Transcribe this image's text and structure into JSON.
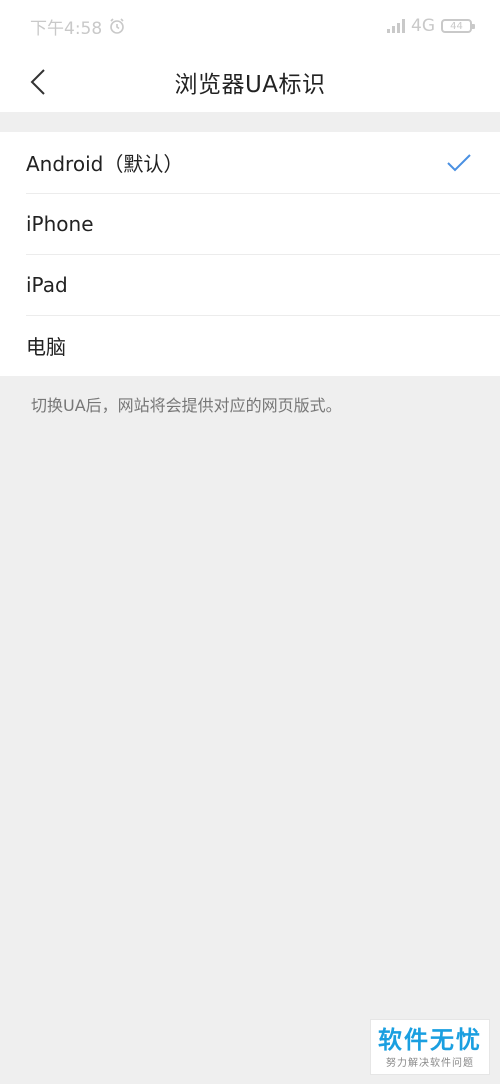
{
  "status_bar": {
    "time": "下午4:58",
    "network": "4G",
    "battery": "44"
  },
  "header": {
    "title": "浏览器UA标识",
    "back_icon": "chevron-left-icon"
  },
  "ua_options": [
    {
      "label": "Android（默认）",
      "selected": true
    },
    {
      "label": "iPhone",
      "selected": false
    },
    {
      "label": "iPad",
      "selected": false
    },
    {
      "label": "电脑",
      "selected": false
    }
  ],
  "hint_text": "切换UA后，网站将会提供对应的网页版式。",
  "watermark": {
    "title": "软件无忧",
    "subtitle": "努力解决软件问题"
  },
  "colors": {
    "accent": "#4a90e2",
    "background": "#efefef",
    "watermark_blue": "#1a9fe0"
  }
}
